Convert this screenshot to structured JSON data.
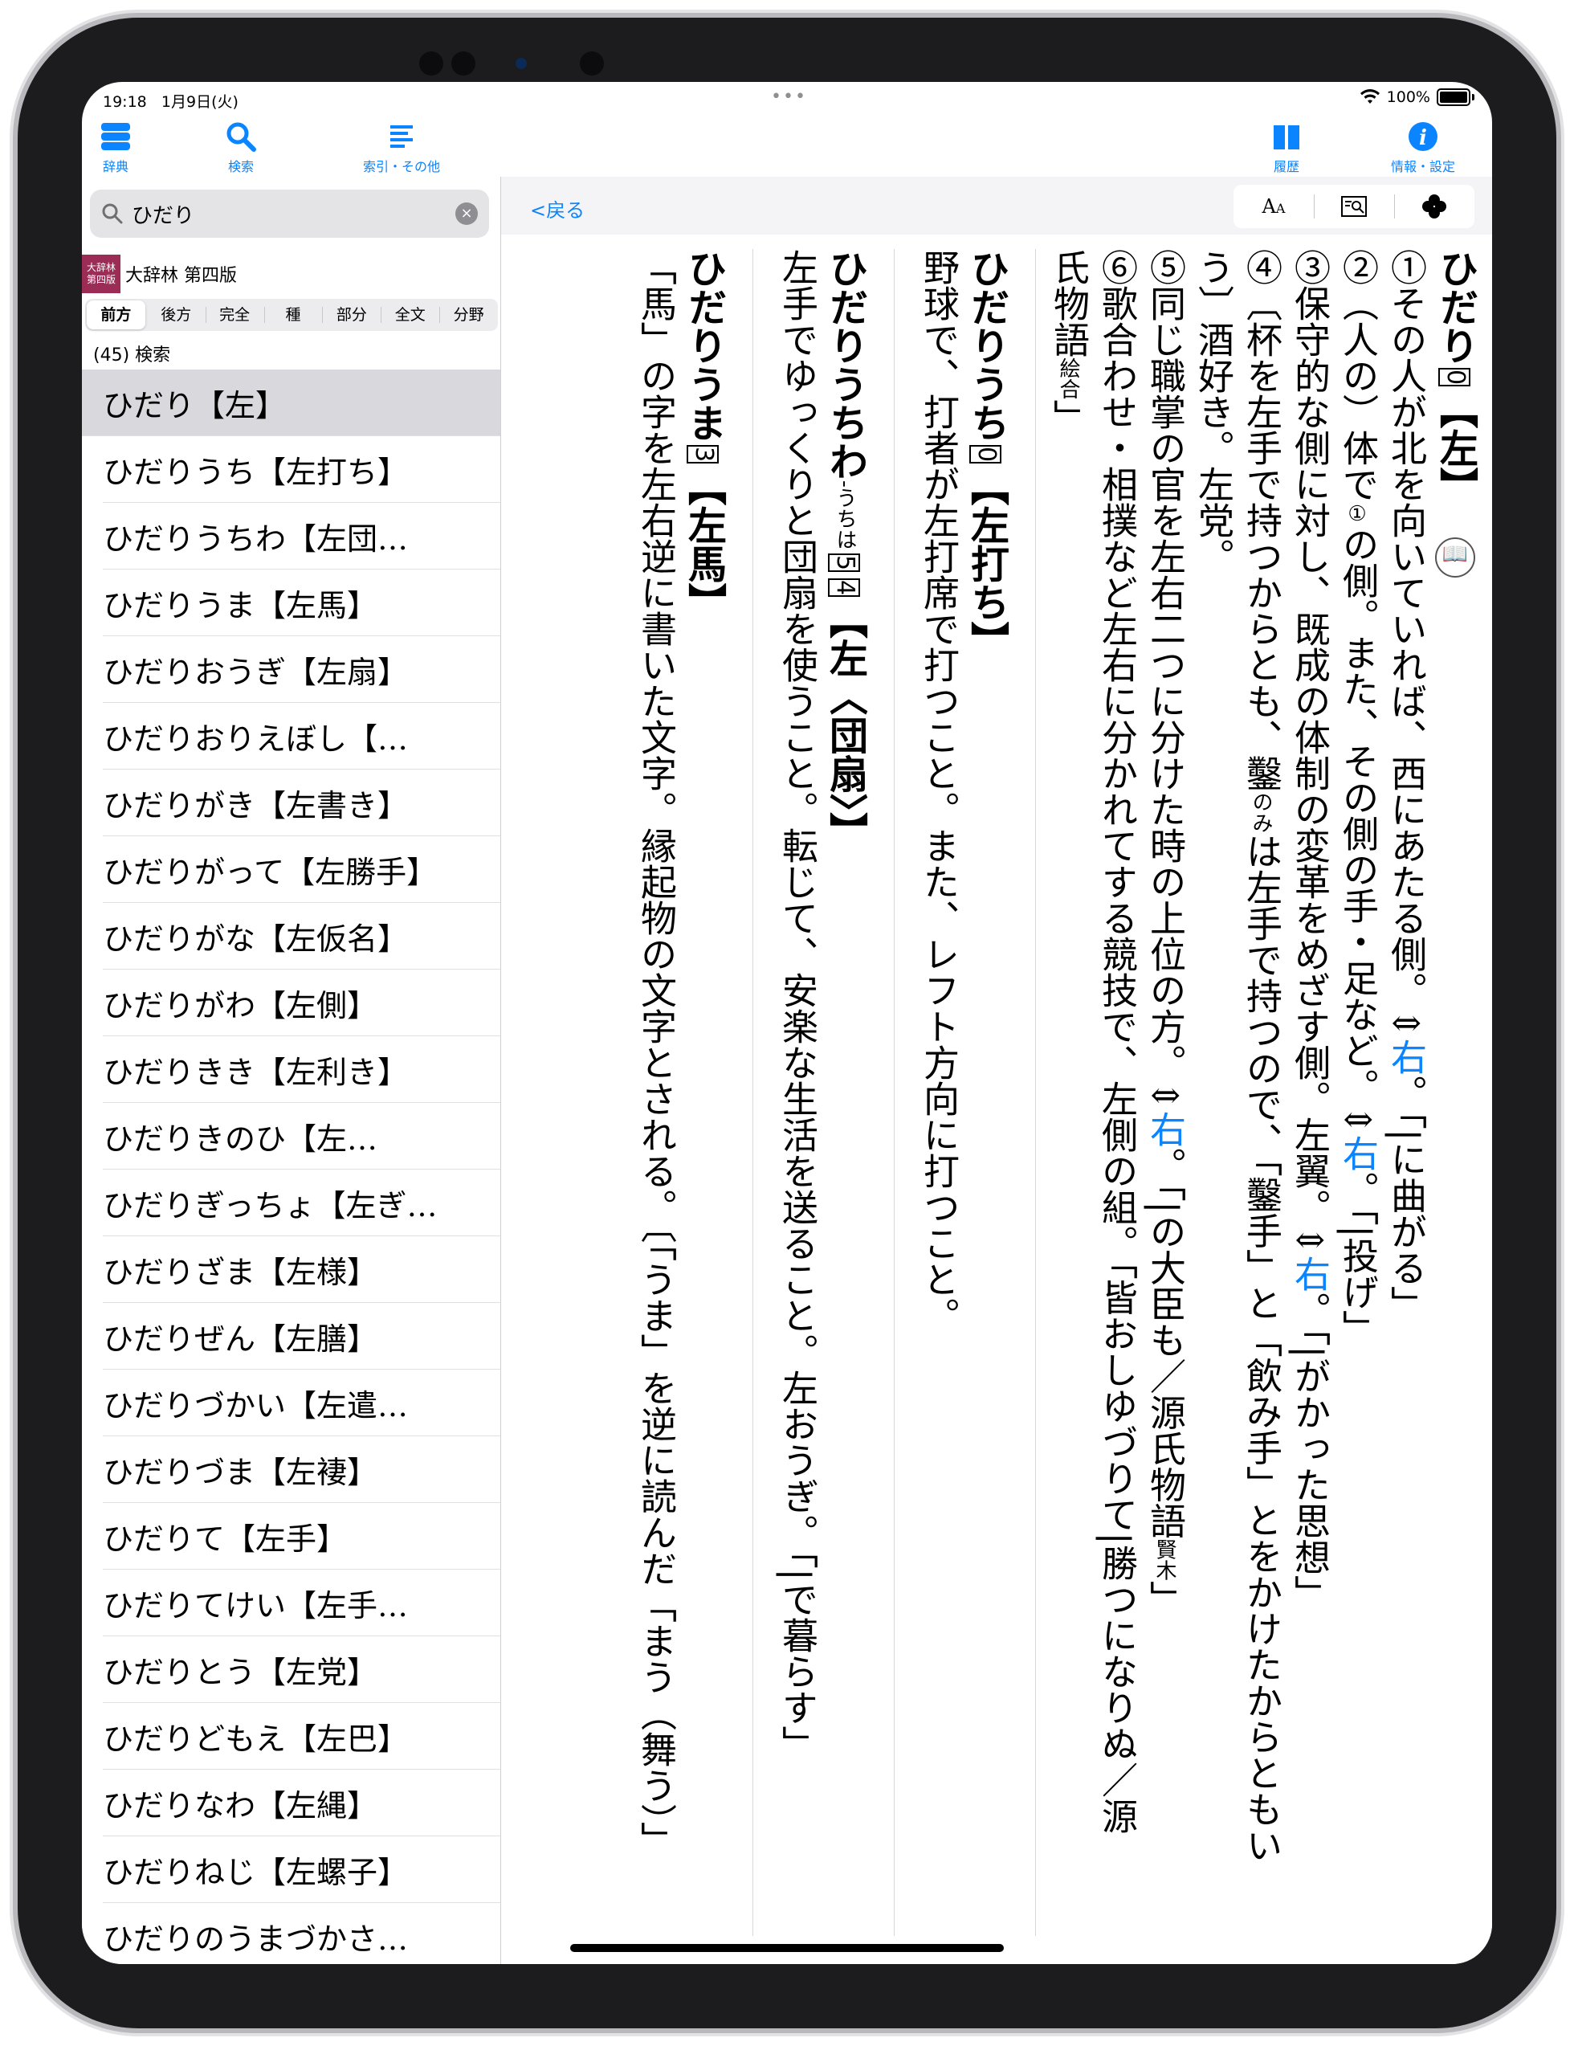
{
  "status": {
    "time": "19:18",
    "date": "1月9日(火)",
    "dots": "•••",
    "battery": "100%"
  },
  "toolbar": {
    "dictionary": "辞典",
    "search": "検索",
    "index": "索引・その他",
    "history": "履歴",
    "settings": "情報・設定"
  },
  "search": {
    "value": "ひだり",
    "clear": "×"
  },
  "dictionary": {
    "logo_line1": "大辞林",
    "logo_line2": "第四版",
    "name": "大辞林 第四版"
  },
  "modes": [
    "前方",
    "後方",
    "完全",
    "種",
    "部分",
    "全文",
    "分野"
  ],
  "result_count": "(45) 検索",
  "results": [
    "ひだり【左】",
    "ひだりうち【左打ち】",
    "ひだりうちわ【左団…",
    "ひだりうま【左馬】",
    "ひだりおうぎ【左扇】",
    "ひだりおりえぼし【…",
    "ひだりがき【左書き】",
    "ひだりがって【左勝手】",
    "ひだりがな【左仮名】",
    "ひだりがわ【左側】",
    "ひだりきき【左利き】",
    "ひだりきのひ【左…",
    "ひだりぎっちょ【左ぎ…",
    "ひだりざま【左様】",
    "ひだりぜん【左膳】",
    "ひだりづかい【左遣…",
    "ひだりづま【左褄】",
    "ひだりて【左手】",
    "ひだりてけい【左手…",
    "ひだりとう【左党】",
    "ひだりどもえ【左巴】",
    "ひだりなわ【左縄】",
    "ひだりねじ【左螺子】",
    "ひだりのうまづかさ…"
  ],
  "nav": {
    "back": "<戻る",
    "font_size_icon": "AA"
  },
  "entry": {
    "e1": {
      "head": "ひだり",
      "accent": "0",
      "kanji": "【左】",
      "s1a": "①その人が北を向いていれば、西にあたる側。⇕",
      "s1link": "右",
      "s1b": "。「",
      "s1dash": "|",
      "s1c": "に曲がる」",
      "s2a": "②（人の）体で",
      "s2circ": "①",
      "s2b": "の側。また、その側の手・足など。⇕",
      "s2link": "右",
      "s2c": "。「",
      "s2dash": "|",
      "s2d": "投げ」",
      "s3a": "③保守的な側に対し、既成の体制の変革をめざす側。左翼。⇕",
      "s3link": "右",
      "s3b": "。「",
      "s3dash": "|",
      "s3c": "がかった思想」",
      "s4a": "④〔杯を左手で持つからとも、",
      "s4b": "鑿",
      "s4ruby": "のみ",
      "s4c": "は左手で持つので、「鑿手」と「飲み手」とをかけたからともい",
      "s4d": "う〕酒好き。左党。",
      "s5a": "⑤同じ職掌の官を左右二つに分けた時の上位の方。⇕",
      "s5link": "右",
      "s5b": "。「",
      "s5dash": "|",
      "s5c": "の大臣も／源氏物語",
      "s5src": "賢木",
      "s5d": "」",
      "s6a": "⑥歌合わせ・相撲など左右に分かれてする競技で、左側の組。「皆おしゆづりて",
      "s6dash": "|",
      "s6b": "勝つになりぬ／源",
      "s6c": "氏物語",
      "s6src": "絵合",
      "s6d": "」"
    },
    "e2": {
      "head": "ひだりうち",
      "accent": "0",
      "kanji": "【左打ち】",
      "body": "野球で、打者が左打席で打つこと。また、レフト方向に打つこと。"
    },
    "e3": {
      "head": "ひだりうちわ",
      "alt": "-うちは",
      "accent1": "5",
      "accent2": "4",
      "kanji": "【左〈団扇〉】",
      "body_a": "左手でゆっくりと団扇を使うこと。転じて、安楽な生活を送ること。左おうぎ。「",
      "dash": "|",
      "body_b": "で暮らす」"
    },
    "e4": {
      "head": "ひだりうま",
      "accent": "3",
      "kanji": "【左馬】",
      "body": "「馬」の字を左右逆に書いた文字。縁起物の文字とされる。〔「うま」を逆に読んだ「まう（舞う）」"
    }
  }
}
